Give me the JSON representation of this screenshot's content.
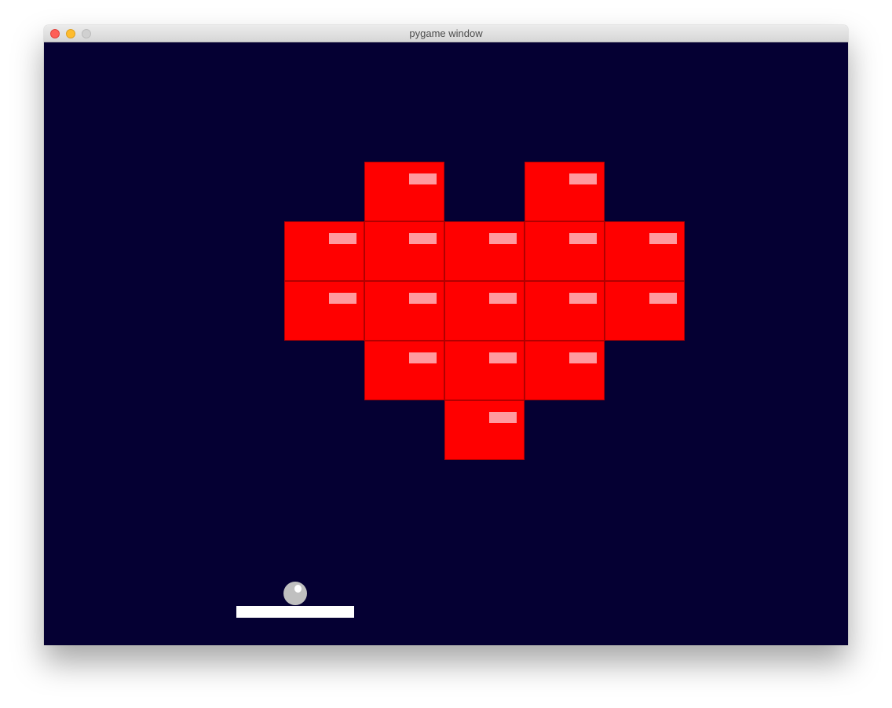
{
  "window": {
    "title": "pygame window"
  },
  "colors": {
    "background": "#050033",
    "brick": "#ff0000",
    "brick_shine": "#ff9a9f",
    "paddle": "#ffffff",
    "ball": "#c0c0c0",
    "traffic_close": "#fe5f57",
    "traffic_minimize": "#febc2e",
    "traffic_zoom": "#d0d0d0"
  },
  "bricks": [
    {
      "row": 0,
      "col": 1
    },
    {
      "row": 0,
      "col": 3
    },
    {
      "row": 1,
      "col": 0
    },
    {
      "row": 1,
      "col": 1
    },
    {
      "row": 1,
      "col": 2
    },
    {
      "row": 1,
      "col": 3
    },
    {
      "row": 1,
      "col": 4
    },
    {
      "row": 2,
      "col": 0
    },
    {
      "row": 2,
      "col": 1
    },
    {
      "row": 2,
      "col": 2
    },
    {
      "row": 2,
      "col": 3
    },
    {
      "row": 2,
      "col": 4
    },
    {
      "row": 3,
      "col": 1
    },
    {
      "row": 3,
      "col": 2
    },
    {
      "row": 3,
      "col": 3
    },
    {
      "row": 4,
      "col": 2
    }
  ]
}
